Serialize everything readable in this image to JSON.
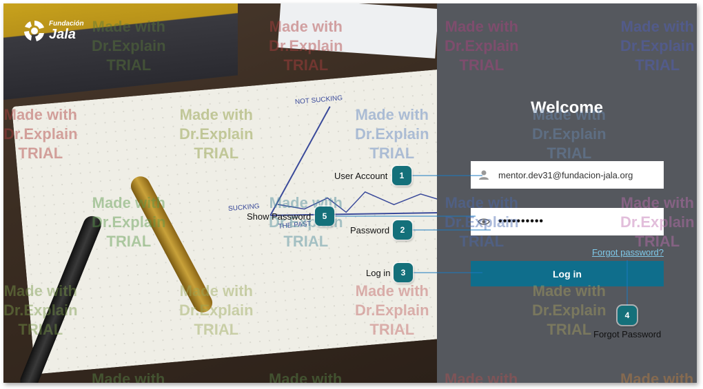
{
  "brand": {
    "small": "Fundación",
    "big": "Jala"
  },
  "login": {
    "title": "Welcome",
    "user_value": "mentor.dev31@fundacion-jala.org",
    "password_mask": "••••••••••",
    "forgot_link": "Forgot password?",
    "login_button": "Log in"
  },
  "callouts": [
    {
      "number": "1",
      "label": "User Account"
    },
    {
      "number": "2",
      "label": "Password"
    },
    {
      "number": "3",
      "label": "Log in"
    },
    {
      "number": "4",
      "label": "Forgot Password"
    },
    {
      "number": "5",
      "label": "Show Password"
    }
  ],
  "sketch": {
    "label_top": "NOT SUCKING",
    "label_left": "SUCKING",
    "label_bottom": "THE PAST"
  },
  "watermark": {
    "line1": "Made with",
    "line2": "Dr.Explain",
    "line3": "TRIAL"
  },
  "colors": {
    "panel": "#55585e",
    "accent": "#0f6e8c",
    "badge": "#14707a",
    "link": "#7fc8e8"
  },
  "icons": {
    "user": "user-icon",
    "eye": "eye-icon",
    "logo": "jala-logo-icon"
  }
}
